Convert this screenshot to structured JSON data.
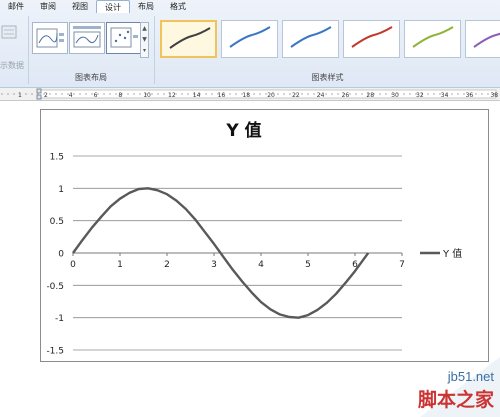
{
  "ribbon": {
    "tabs": [
      {
        "label": "邮件",
        "active": false
      },
      {
        "label": "审阅",
        "active": false
      },
      {
        "label": "视图",
        "active": false
      },
      {
        "label": "设计",
        "active": true
      },
      {
        "label": "布局",
        "active": false
      },
      {
        "label": "格式",
        "active": false
      }
    ],
    "dimmed_button": "示数据",
    "groups": {
      "layout_label": "图表布局",
      "styles_label": "图表样式"
    },
    "style_colors": [
      "#404040",
      "#3a76c4",
      "#3a76c4",
      "#c0392b",
      "#8db33a",
      "#8b5fb8"
    ]
  },
  "ruler": {
    "labels": [
      "1",
      "2",
      "4",
      "6",
      "8",
      "10",
      "12",
      "14",
      "16",
      "18",
      "20",
      "22",
      "24",
      "26",
      "28",
      "30",
      "32",
      "34",
      "36",
      "38"
    ]
  },
  "chart_data": {
    "type": "line",
    "title": "Y 值",
    "x": [
      0,
      0.2,
      0.4,
      0.6,
      0.8,
      1.0,
      1.2,
      1.4,
      1.6,
      1.8,
      2.0,
      2.2,
      2.4,
      2.6,
      2.8,
      3.0,
      3.2,
      3.4,
      3.6,
      3.8,
      4.0,
      4.2,
      4.4,
      4.6,
      4.8,
      5.0,
      5.2,
      5.4,
      5.6,
      5.8,
      6.0,
      6.2,
      6.28
    ],
    "series": [
      {
        "name": "Y 值",
        "color": "#595959",
        "values": [
          0,
          0.2,
          0.39,
          0.56,
          0.72,
          0.84,
          0.93,
          0.99,
          1.0,
          0.97,
          0.91,
          0.81,
          0.68,
          0.52,
          0.33,
          0.14,
          -0.06,
          -0.26,
          -0.44,
          -0.61,
          -0.76,
          -0.87,
          -0.95,
          -0.99,
          -1.0,
          -0.96,
          -0.88,
          -0.77,
          -0.63,
          -0.46,
          -0.28,
          -0.08,
          0
        ]
      }
    ],
    "xlim": [
      0,
      7
    ],
    "ylim": [
      -1.5,
      1.5
    ],
    "xticks": [
      "0",
      "1",
      "2",
      "3",
      "4",
      "5",
      "6",
      "7"
    ],
    "yticks": [
      "1.5",
      "1",
      "0.5",
      "0",
      "-0.5",
      "-1",
      "-1.5"
    ],
    "grid": true,
    "legend": "right"
  },
  "watermark": {
    "url": "jb51.net",
    "brand": "脚本之家"
  }
}
